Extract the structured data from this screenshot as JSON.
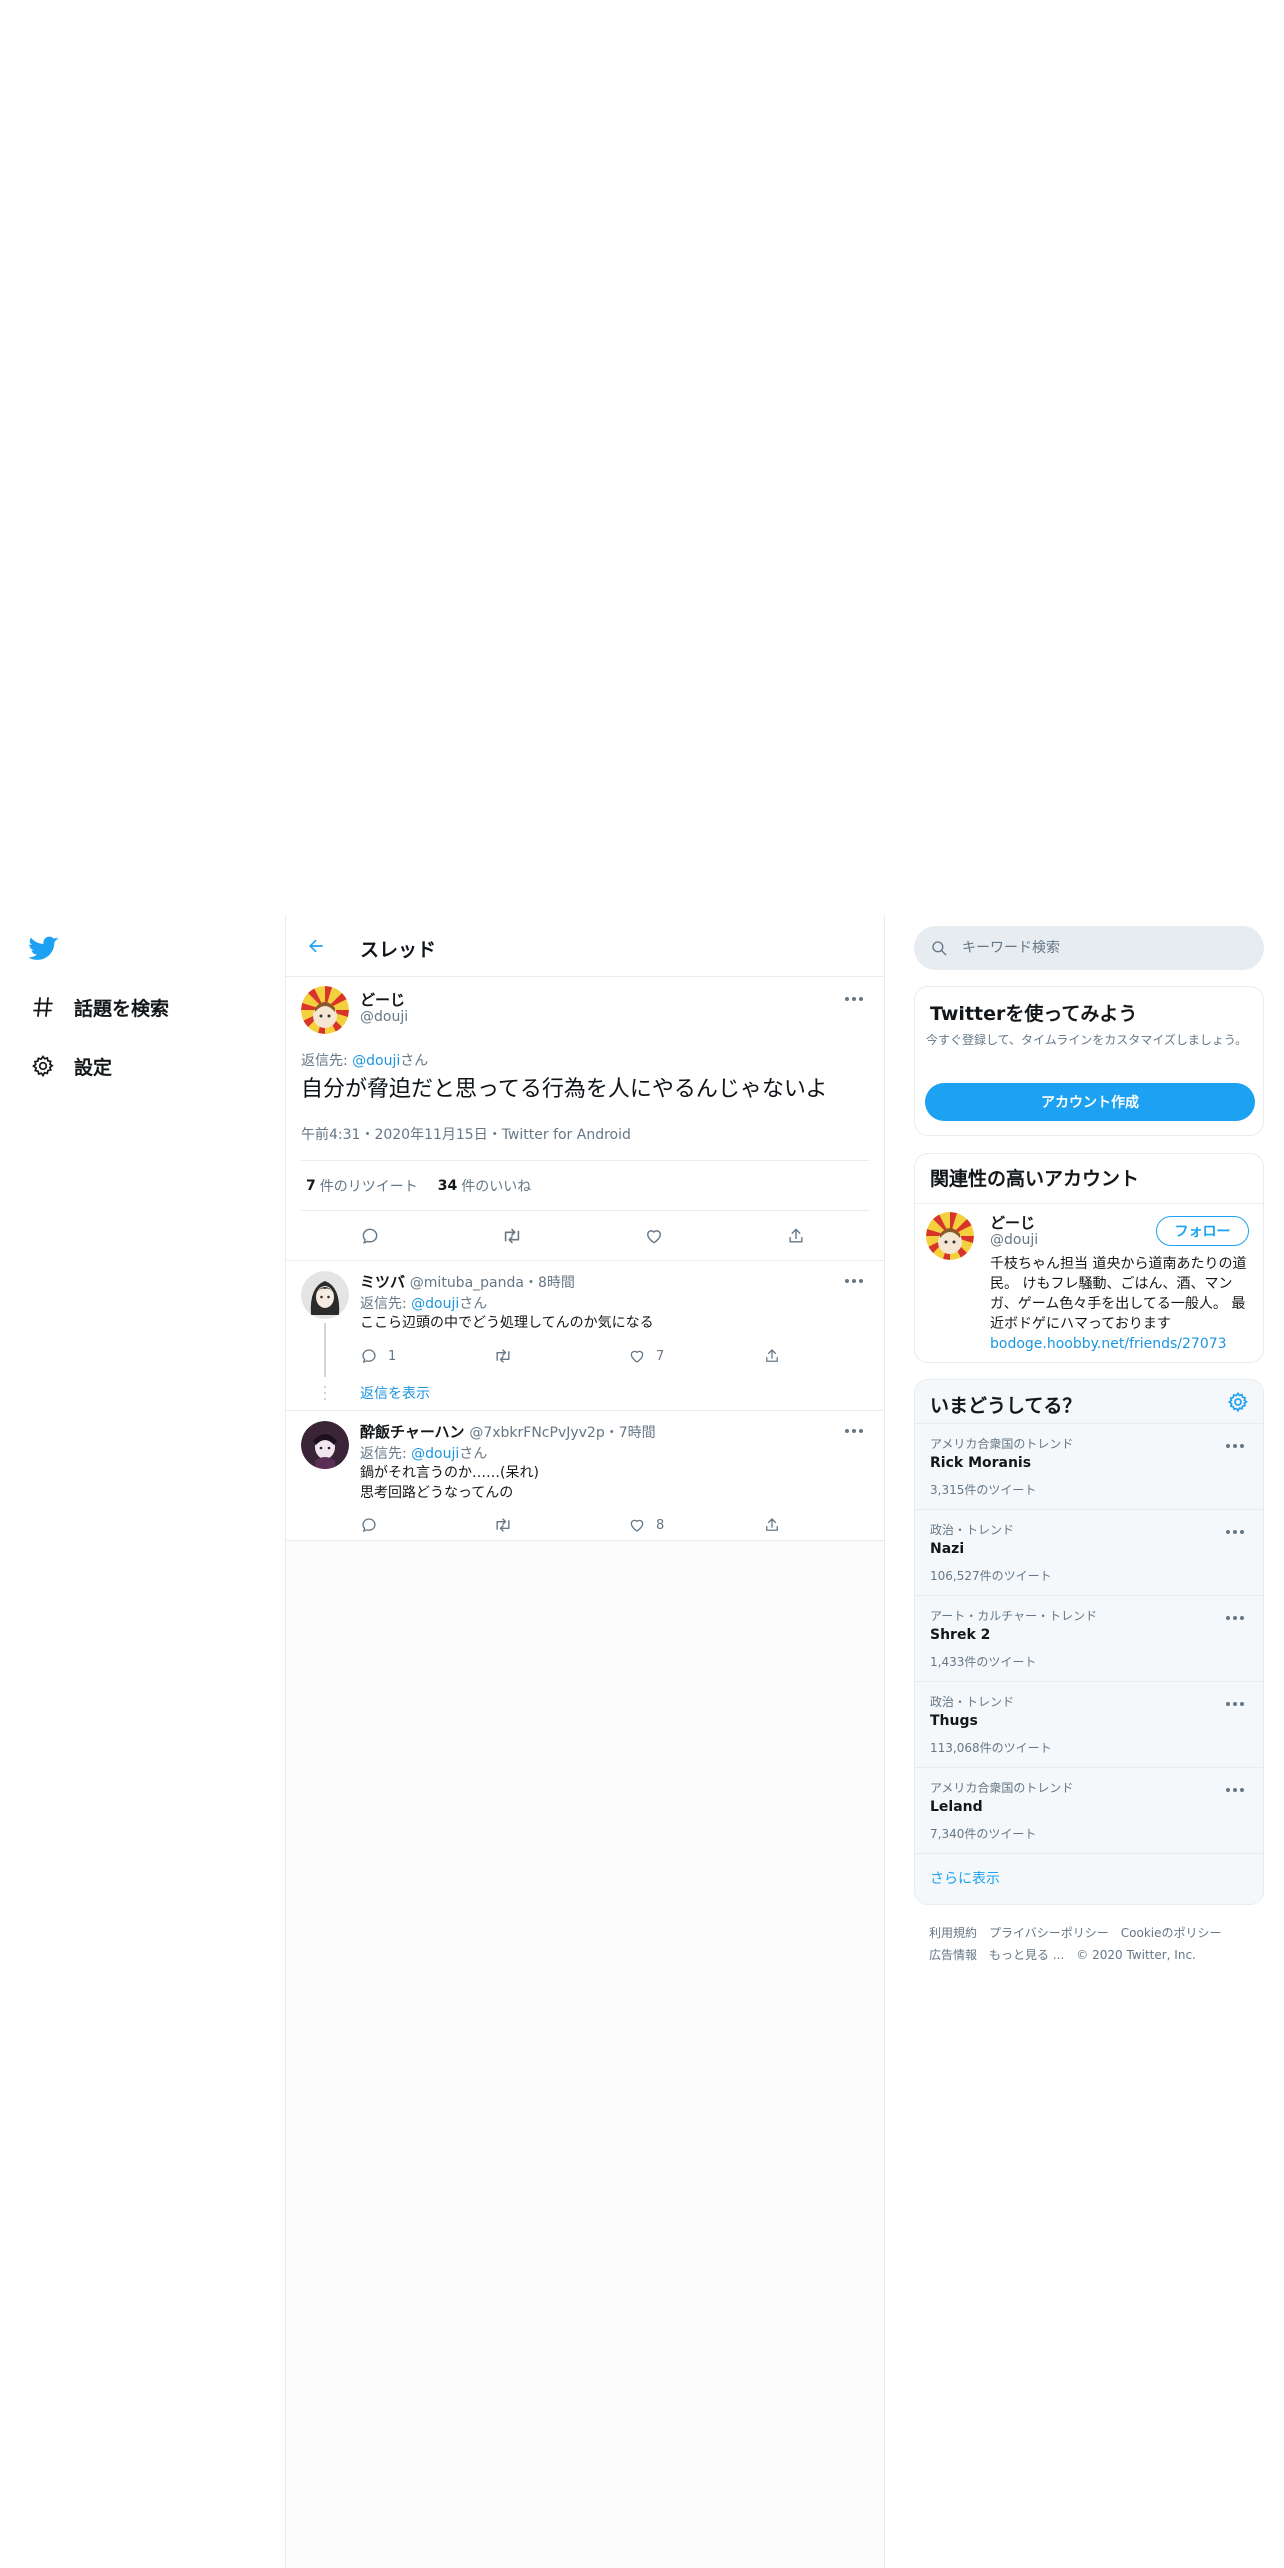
{
  "nav": {
    "items": [
      {
        "label": "話題を検索",
        "icon": "hashtag-icon"
      },
      {
        "label": "設定",
        "icon": "gear-icon"
      }
    ]
  },
  "header": {
    "title": "スレッド"
  },
  "focal_tweet": {
    "name": "どーじ",
    "handle": "@douji",
    "reply_prefix": "返信先: ",
    "reply_to": "@douji",
    "reply_suffix": "さん",
    "text": "自分が脅迫だと思ってる行為を人にやるんじゃないよ",
    "meta": "午前4:31・2020年11月15日・Twitter for Android",
    "retweets": "7",
    "retweets_label": "件のリツイート",
    "likes": "34",
    "likes_label": "件のいいね"
  },
  "replies": [
    {
      "name": "ミツバ",
      "handle": "@mituba_panda",
      "time": "・8時間",
      "reply_prefix": "返信先: ",
      "reply_to": "@douji",
      "reply_suffix": "さん",
      "lines": [
        "ここら辺頭の中でどう処理してんのか気になる"
      ],
      "reply_count": "1",
      "retweet_count": "",
      "like_count": "7",
      "show_replies": "返信を表示"
    },
    {
      "name": "酔飯チャーハン",
      "handle": "@7xbkrFNcPvJyv2p",
      "time": "・7時間",
      "reply_prefix": "返信先: ",
      "reply_to": "@douji",
      "reply_suffix": "さん",
      "lines": [
        "鍋がそれ言うのか……(呆れ)",
        "思考回路どうなってんの"
      ],
      "reply_count": "",
      "retweet_count": "",
      "like_count": "8"
    }
  ],
  "search": {
    "placeholder": "キーワード検索"
  },
  "signup": {
    "title": "Twitterを使ってみよう",
    "desc": "今すぐ登録して、タイムラインをカスタマイズしましょう。",
    "button": "アカウント作成"
  },
  "related": {
    "title": "関連性の高いアカウント",
    "name": "どーじ",
    "handle": "@douji",
    "follow": "フォロー",
    "bio": "千枝ちゃん担当 道央から道南あたりの道民。 けもフレ騒動、ごはん、酒、マンガ、ゲーム色々手を出してる一般人。 最近ボドゲにハマっております ",
    "bio_link": "bodoge.hoobby.net/friends/27073"
  },
  "trends": {
    "title": "いまどうしてる？",
    "items": [
      {
        "context": "アメリカ合衆国のトレンド",
        "name": "Rick Moranis",
        "count": "3,315件のツイート"
      },
      {
        "context": "政治・トレンド",
        "name": "Nazi",
        "count": "106,527件のツイート"
      },
      {
        "context": "アート・カルチャー・トレンド",
        "name": "Shrek 2",
        "count": "1,433件のツイート"
      },
      {
        "context": "政治・トレンド",
        "name": "Thugs",
        "count": "113,068件のツイート"
      },
      {
        "context": "アメリカ合衆国のトレンド",
        "name": "Leland",
        "count": "7,340件のツイート"
      }
    ],
    "show_more": "さらに表示"
  },
  "footer": {
    "links": [
      "利用規約",
      "プライバシーポリシー",
      "Cookieのポリシー",
      "広告情報",
      "もっと見る ..."
    ],
    "copyright": "© 2020 Twitter, Inc."
  },
  "colors": {
    "accent": "#1da1f2",
    "link": "#1b95e0",
    "muted": "#657786",
    "border": "#e6ecf0"
  }
}
